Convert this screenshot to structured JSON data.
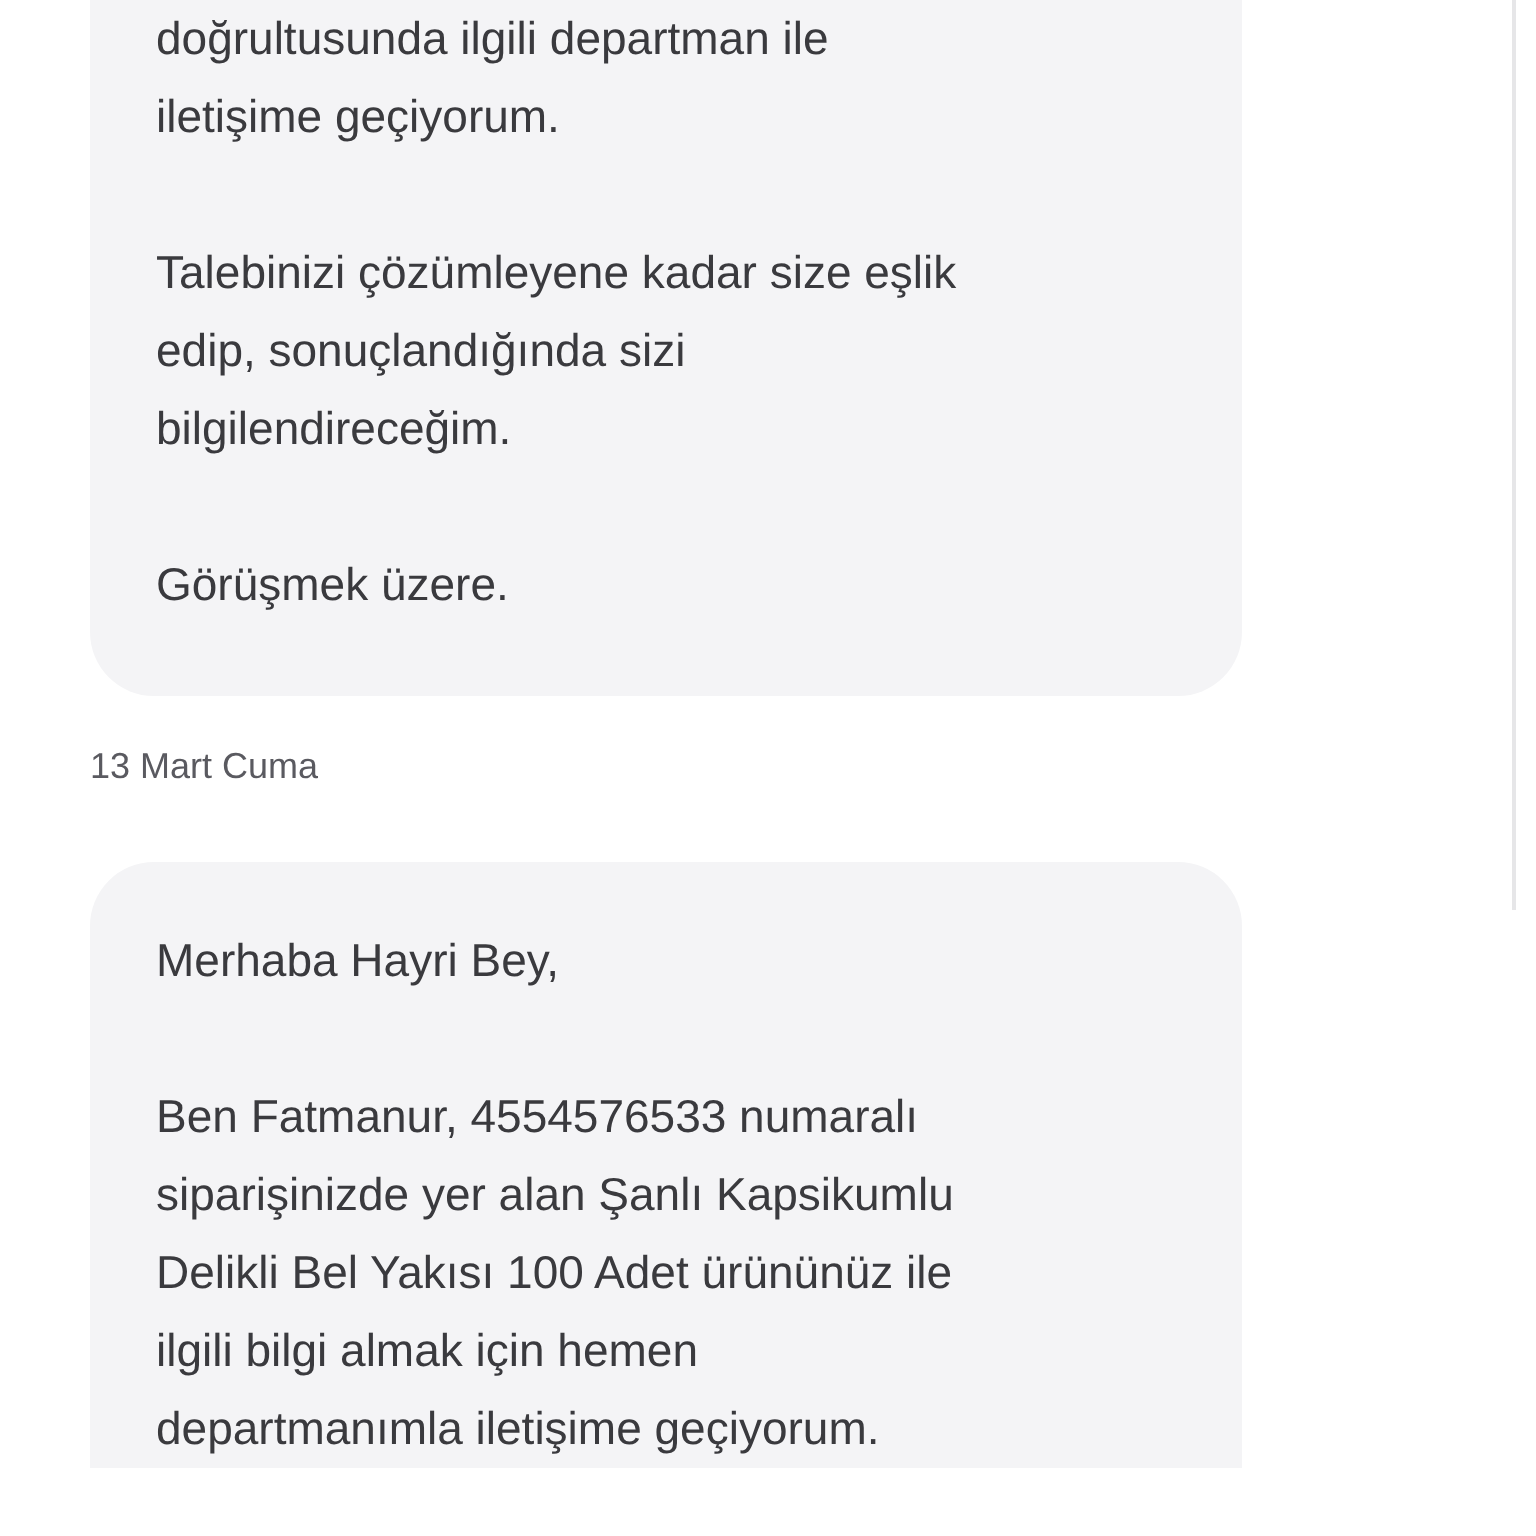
{
  "messages_before": [
    {
      "paragraphs": [
        [
          "doğrultusunda ilgili departman ile",
          "iletişime geçiyorum."
        ],
        [
          "Talebinizi çözümleyene kadar size eşlik",
          "edip, sonuçlandığında sizi",
          "bilgilendireceğim."
        ],
        [
          "Görüşmek üzere."
        ]
      ]
    }
  ],
  "date_separator": "13 Mart Cuma",
  "messages_after": [
    {
      "paragraphs": [
        [
          "Merhaba Hayri Bey,"
        ],
        [
          "Ben Fatmanur, 4554576533 numaralı",
          "siparişinizde yer alan Şanlı Kapsikumlu",
          "Delikli Bel Yakısı 100 Adet ürününüz ile",
          "ilgili bilgi almak için hemen",
          "departmanımla iletişime geçiyorum."
        ]
      ]
    }
  ]
}
